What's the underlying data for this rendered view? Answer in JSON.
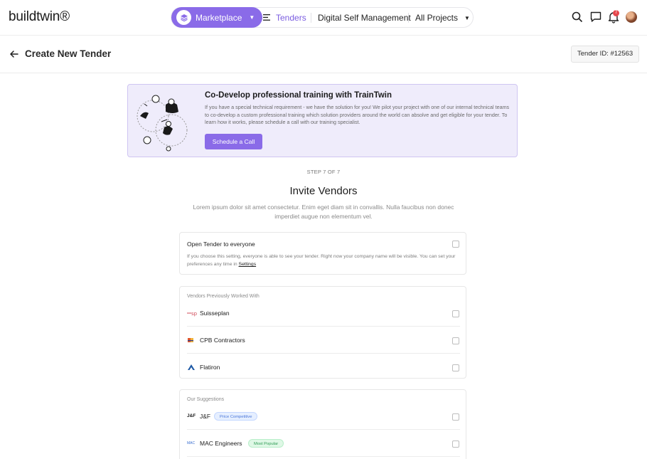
{
  "app": {
    "logo": "buildtwin®"
  },
  "nav": {
    "marketplace": "Marketplace",
    "tenders": "Tenders",
    "digital_self_management": "Digital Self Management",
    "projects": "All Projects",
    "notifications_count": "7"
  },
  "header": {
    "title": "Create New Tender",
    "tender_id": "Tender ID: #12563"
  },
  "promo": {
    "title": "Co-Develop professional training with TrainTwin",
    "body": "If you have a special technical requirement - we have the solution for you! We pilot your project with one of our internal technical teams to co-develop a custom professional training which solution providers around the world can absolve and get eligible for your tender. To learn how it works, please schedule a call with our training specialist.",
    "button": "Schedule a Call"
  },
  "step": "STEP 7 OF 7",
  "section": {
    "title": "Invite Vendors",
    "subtitle": "Lorem ipsum dolor sit amet consectetur. Enim eget diam sit in convallis. Nulla faucibus non donec imperdiet augue non elementum vel."
  },
  "open_tender": {
    "title": "Open Tender to everyone",
    "desc": "If you choose this setting, everyone is able to see your tender. Right now your company name will be visible. You can set your preferences any time in ",
    "link": "Settings"
  },
  "previous_vendors": {
    "caption": "Vendors Previously Worked With",
    "items": [
      {
        "name": "Suisseplan",
        "logo": "suisseplan-logo"
      },
      {
        "name": "CPB Contractors",
        "logo": "cpb-logo"
      },
      {
        "name": "Flatiron",
        "logo": "flatiron-logo"
      }
    ]
  },
  "suggestions": {
    "caption": "Our Suggestions",
    "items": [
      {
        "name": "J&F",
        "logo_text": "J&F",
        "tag": "Price Competitive"
      },
      {
        "name": "MAC Engineers",
        "logo_text": "MAC",
        "tag": "Most Popular"
      }
    ]
  },
  "colors": {
    "accent": "#8a6be8",
    "banner_bg": "#efecfb",
    "notify": "#e5484d"
  }
}
